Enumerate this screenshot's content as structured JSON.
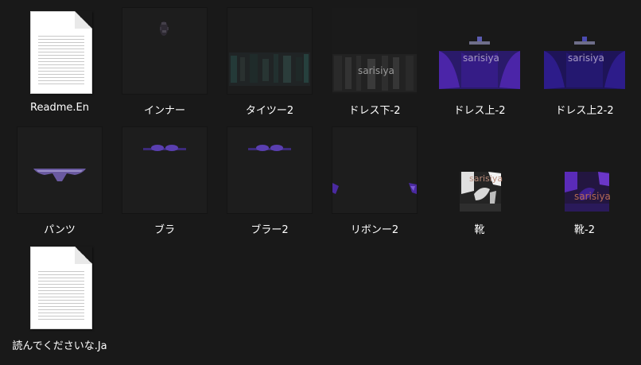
{
  "files": [
    {
      "name": "Readme.En",
      "kind": "document"
    },
    {
      "name": "インナー",
      "kind": "texture"
    },
    {
      "name": "タイツー2",
      "kind": "texture"
    },
    {
      "name": "ドレス下-2",
      "kind": "texture"
    },
    {
      "name": "ドレス上-2",
      "kind": "texture"
    },
    {
      "name": "ドレス上2-2",
      "kind": "texture"
    },
    {
      "name": "パンツ",
      "kind": "texture"
    },
    {
      "name": "ブラ",
      "kind": "texture"
    },
    {
      "name": "ブラー2",
      "kind": "texture"
    },
    {
      "name": "リボンー2",
      "kind": "texture"
    },
    {
      "name": "靴",
      "kind": "texture"
    },
    {
      "name": "靴-2",
      "kind": "texture"
    },
    {
      "name": "読んでくださいな.Ja",
      "kind": "document"
    }
  ],
  "thumb_text": {
    "dress_lower": "sarisiya",
    "dress_upper": "sarisiya",
    "dress_upper2": "sarisiya",
    "shoes": "sarisiya",
    "shoes2": "sarisiya"
  },
  "colors": {
    "background": "#191919",
    "label": "#ffffff",
    "purple": "#5a2bb8"
  },
  "icons": {
    "document": "text-document-icon",
    "texture": "image-thumbnail-icon"
  }
}
